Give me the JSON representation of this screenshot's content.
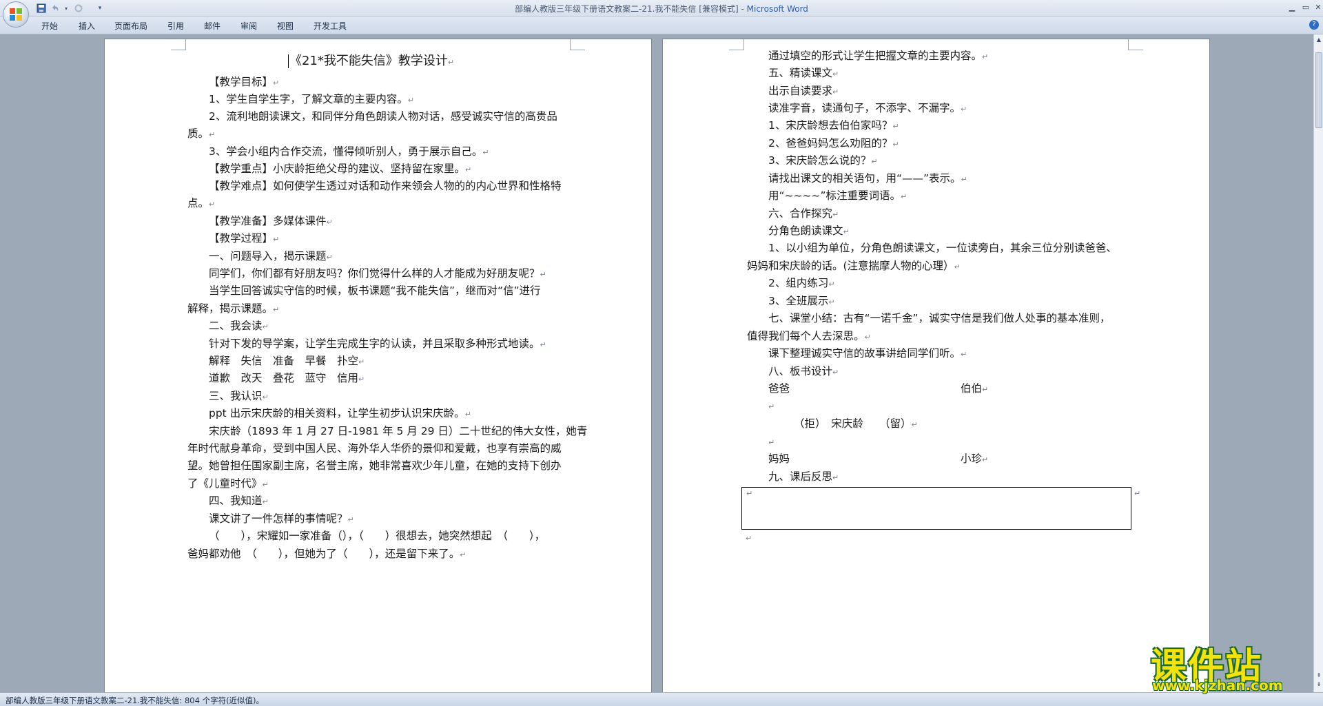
{
  "window": {
    "title_doc": "部编人教版三年级下册语文教案二-21.我不能失信 [兼容模式] - ",
    "title_app": "Microsoft Word"
  },
  "ribbon": {
    "tabs": [
      "开始",
      "插入",
      "页面布局",
      "引用",
      "邮件",
      "审阅",
      "视图",
      "开发工具"
    ]
  },
  "status": {
    "text": "部编人教版三年级下册语文教案二-21.我不能失信: 804 个字符(近似值)。"
  },
  "watermark": {
    "title": "课件站",
    "url": "www.kjzhan.com"
  },
  "left_page": {
    "heading": "《21*我不能失信》教学设计",
    "lines": [
      "【教学目标】",
      "1、学生自学生字，了解文章的主要内容。",
      "2、流利地朗读课文，和同伴分角色朗读人物对话，感受诚实守信的高贵品",
      "质。",
      "3、学会小组内合作交流，懂得倾听别人，勇于展示自己。",
      "【教学重点】小庆龄拒绝父母的建议、坚持留在家里。",
      "【教学难点】如何使学生透过对话和动作来领会人物的的内心世界和性格特",
      "点。",
      "【教学准备】多媒体课件",
      "【教学过程】",
      "一、问题导入，揭示课题",
      "同学们，你们都有好朋友吗？你们觉得什么样的人才能成为好朋友呢？",
      "当学生回答诚实守信的时候，板书课题“我不能失信”，继而对“信”进行",
      "解释，揭示课题。",
      "二、我会读",
      "针对下发的导学案，让学生完成生字的认读，并且采取多种形式地读。",
      "解释　失信　准备　早餐　扑空",
      "道歉　改天　叠花　蓝守　信用",
      "三、我认识",
      "ppt 出示宋庆龄的相关资料，让学生初步认识宋庆龄。",
      "宋庆龄（1893 年 1 月 27 日-1981 年 5 月 29 日）二十世纪的伟大女性，她青",
      "年时代献身革命，受到中国人民、海外华人华侨的景仰和爱戴，也享有崇高的威",
      "望。她曾担任国家副主席，名誉主席，她非常喜欢少年儿童，在她的支持下创办",
      "了《儿童时代》",
      "四、我知道",
      "课文讲了一件怎样的事情呢？",
      "（　　），宋耀如一家准备（），（　　）很想去，她突然想起　（　　），",
      "爸妈都劝他　（　　），但她为了（　　），还是留下来了。"
    ]
  },
  "right_page": {
    "lines": [
      "通过填空的形式让学生把握文章的主要内容。",
      "五、精读课文",
      "出示自读要求",
      "读准字音，读通句子，不添字、不漏字。",
      "1、宋庆龄想去伯伯家吗？",
      "2、爸爸妈妈怎么劝阻的？",
      "3、宋庆龄怎么说的？",
      "请找出课文的相关语句，用“——”表示。",
      "用“~~~~”标注重要词语。",
      "六、合作探究",
      "分角色朗读课文",
      "1、以小组为单位，分角色朗读课文，一位读旁白，其余三位分别读爸爸、",
      "妈妈和宋庆龄的话。(注意揣摩人物的心理）",
      "2、组内练习",
      "3、全班展示",
      "七、课堂小结：古有“一诺千金”，诚实守信是我们做人处事的基本准则，",
      "值得我们每个人去深思。",
      "课下整理诚实守信的故事讲给同学们听。",
      "八、板书设计"
    ],
    "board": {
      "top_left": "爸爸",
      "top_right": "伯伯",
      "middle": "（拒）　宋庆龄　　（留）",
      "bottom_left": "妈妈",
      "bottom_right": "小珍"
    },
    "reflection": "九、课后反思"
  }
}
